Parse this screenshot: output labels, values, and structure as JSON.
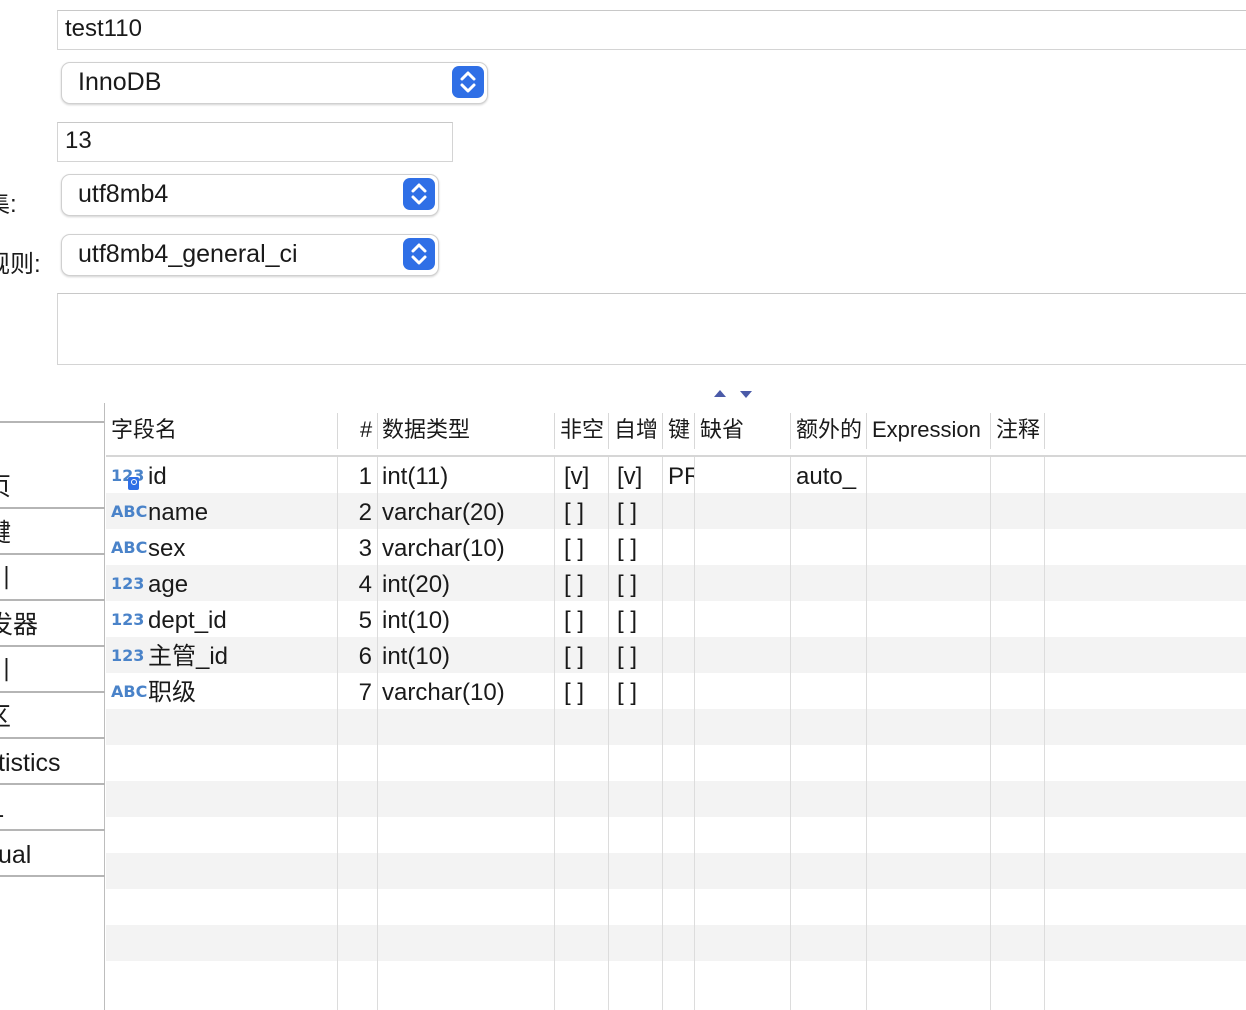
{
  "form": {
    "table_name": "test110",
    "engine": "InnoDB",
    "auto_increment": "13",
    "charset_label_fragment": "集:",
    "charset": "utf8mb4",
    "collation_label_fragment": "规则:",
    "collation": "utf8mb4_general_ci",
    "comment": ""
  },
  "sidebar": {
    "tabs": [
      {
        "label": "页"
      },
      {
        "label": "键"
      },
      {
        "label": "引"
      },
      {
        "label": "发器"
      },
      {
        "label": "引"
      },
      {
        "label": "区"
      },
      {
        "label": "tistics"
      },
      {
        "label": "L"
      },
      {
        "label": "ual"
      }
    ]
  },
  "table": {
    "headers": {
      "name": "字段名",
      "num": "#",
      "type": "数据类型",
      "not_null": "非空",
      "auto_inc": "自增",
      "key": "键",
      "default": "缺省",
      "extra": "额外的",
      "expression": "Expression",
      "comment": "注释"
    },
    "rows": [
      {
        "icon": "123",
        "name": "id",
        "num": "1",
        "type": "int(11)",
        "not_null": "[v]",
        "auto_inc": "[v]",
        "key": "PR",
        "default": "",
        "extra": "auto_",
        "expression": "",
        "comment": ""
      },
      {
        "icon": "ABC",
        "name": "name",
        "num": "2",
        "type": "varchar(20)",
        "not_null": "[ ]",
        "auto_inc": "[ ]",
        "key": "",
        "default": "",
        "extra": "",
        "expression": "",
        "comment": ""
      },
      {
        "icon": "ABC",
        "name": "sex",
        "num": "3",
        "type": "varchar(10)",
        "not_null": "[ ]",
        "auto_inc": "[ ]",
        "key": "",
        "default": "",
        "extra": "",
        "expression": "",
        "comment": ""
      },
      {
        "icon": "123",
        "name": "age",
        "num": "4",
        "type": "int(20)",
        "not_null": "[ ]",
        "auto_inc": "[ ]",
        "key": "",
        "default": "",
        "extra": "",
        "expression": "",
        "comment": ""
      },
      {
        "icon": "123",
        "name": "dept_id",
        "num": "5",
        "type": "int(10)",
        "not_null": "[ ]",
        "auto_inc": "[ ]",
        "key": "",
        "default": "",
        "extra": "",
        "expression": "",
        "comment": ""
      },
      {
        "icon": "123",
        "name": "主管_id",
        "num": "6",
        "type": "int(10)",
        "not_null": "[ ]",
        "auto_inc": "[ ]",
        "key": "",
        "default": "",
        "extra": "",
        "expression": "",
        "comment": ""
      },
      {
        "icon": "ABC",
        "name": "职级",
        "num": "7",
        "type": "varchar(10)",
        "not_null": "[ ]",
        "auto_inc": "[ ]",
        "key": "",
        "default": "",
        "extra": "",
        "expression": "",
        "comment": ""
      }
    ]
  },
  "icons": {
    "stepper": "up-down-chevron-icon",
    "sort": "sort-arrows-icon",
    "number_type": "number-type-icon",
    "string_type": "string-type-icon",
    "primary_key": "key-icon"
  },
  "colors": {
    "accent": "#2f6fe6",
    "type_icon": "#4a83c9",
    "row_alt": "#f3f3f3"
  }
}
